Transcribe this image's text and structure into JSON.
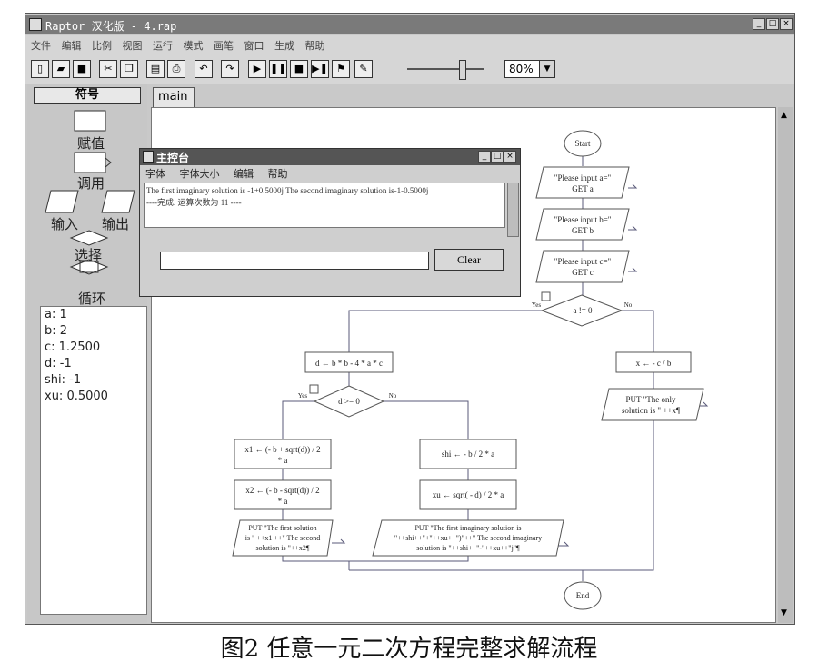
{
  "window": {
    "title": "Raptor 汉化版 - 4.rap",
    "menu": [
      "文件",
      "编辑",
      "比例",
      "视图",
      "运行",
      "模式",
      "画笔",
      "窗口",
      "生成",
      "帮助"
    ]
  },
  "toolbar": {
    "zoom": "80%"
  },
  "palette": {
    "header": "符号",
    "items": [
      "赋值",
      "调用",
      "输入",
      "输出",
      "选择",
      "循环"
    ]
  },
  "watch": [
    "a: 1",
    "b: 2",
    "c: 1.2500",
    "d: -1",
    "shi: -1",
    "xu: 0.5000"
  ],
  "tab": "main",
  "console": {
    "title": "主控台",
    "menu": [
      "字体",
      "字体大小",
      "编辑",
      "帮助"
    ],
    "output_line1": "The first imaginary solution is -1+0.5000j The second imaginary solution is-1-0.5000j",
    "output_line2": "----完成. 运算次数为 11 ----",
    "clear_label": "Clear"
  },
  "flowchart": {
    "start": "Start",
    "in_a_prompt": "\"Please input a=\"",
    "in_a_get": "GET a",
    "in_b_prompt": "\"Please input b=\"",
    "in_b_get": "GET b",
    "in_c_prompt": "\"Please input c=\"",
    "in_c_get": "GET c",
    "cond_a": "a != 0",
    "yes": "Yes",
    "no": "No",
    "assign_d": "d ← b * b - 4 * a * c",
    "assign_x_only": "x ← - c / b",
    "out_only_1": "PUT \"The only",
    "out_only_2": "solution is \" ++x¶",
    "cond_d": "d >= 0",
    "x1_line1": "x1 ← (- b + sqrt(d)) / 2",
    "x1_line2": "* a",
    "x2_line1": "x2 ← (- b - sqrt(d)) / 2",
    "x2_line2": "* a",
    "shi": "shi ← - b / 2 * a",
    "xu": "xu ← sqrt( - d) / 2 * a",
    "out_real_1": "PUT \"The first solution",
    "out_real_2": "is \" ++x1 ++\" The second",
    "out_real_3": "solution is \"++x2¶",
    "out_img_1": "PUT \"The first imaginary solution is",
    "out_img_2": "\"++shi++\"+\"++xu++\")\"++\" The second imaginary",
    "out_img_3": "solution is \"++shi++\"-\"++xu++\"j\"¶",
    "end": "End"
  },
  "caption": "图2  任意一元二次方程完整求解流程"
}
